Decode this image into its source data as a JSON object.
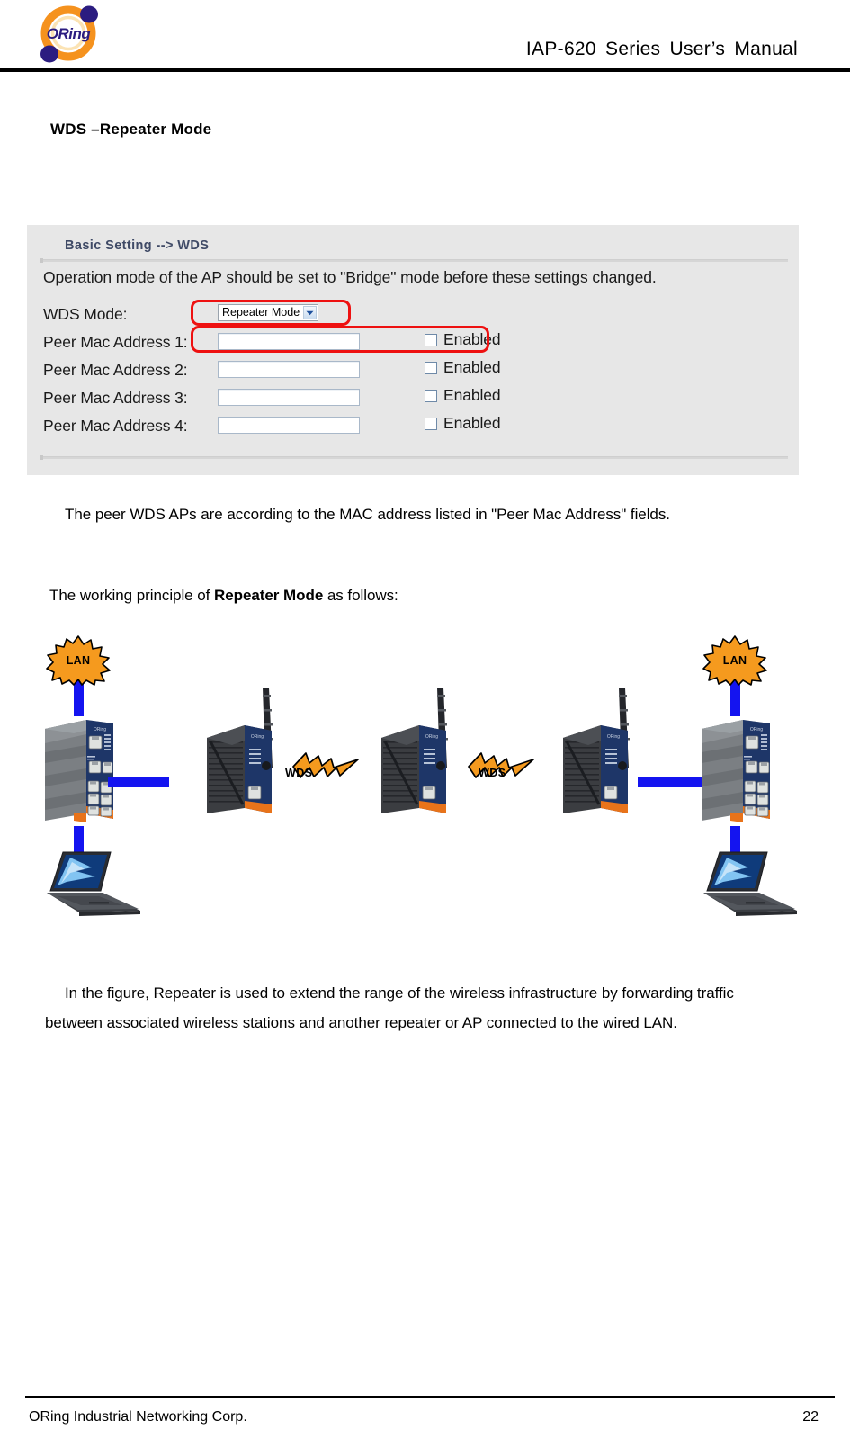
{
  "header": {
    "title": "IAP-620  Series  User’s  Manual",
    "logo_text": "ORing"
  },
  "section": {
    "heading": "WDS –Repeater Mode"
  },
  "panel": {
    "title": "Basic Setting --> WDS",
    "note": "Operation mode of the AP should be set to \"Bridge\" mode before these settings changed.",
    "rows": [
      {
        "label": "WDS Mode:",
        "type": "select",
        "value": "Repeater Mode",
        "checkbox_label": null,
        "checked": false,
        "highlighted": true
      },
      {
        "label": "Peer Mac Address 1:",
        "type": "text",
        "value": "",
        "checkbox_label": "Enabled",
        "checked": false,
        "highlighted": true
      },
      {
        "label": "Peer Mac Address 2:",
        "type": "text",
        "value": "",
        "checkbox_label": "Enabled",
        "checked": false,
        "highlighted": false
      },
      {
        "label": "Peer Mac Address 3:",
        "type": "text",
        "value": "",
        "checkbox_label": "Enabled",
        "checked": false,
        "highlighted": false
      },
      {
        "label": "Peer Mac Address 4:",
        "type": "text",
        "value": "",
        "checkbox_label": "Enabled",
        "checked": false,
        "highlighted": false
      }
    ]
  },
  "body": {
    "paragraph_1": "The peer WDS APs are according to the MAC address listed in \"Peer Mac Address\" fields.",
    "paragraph_2_prefix": "The working principle of ",
    "paragraph_2_bold": "Repeater Mode",
    "paragraph_2_suffix": " as follows:",
    "paragraph_3": "In the figure, Repeater is used to extend the range of the wireless infrastructure by forwarding traffic between associated wireless stations and another repeater or AP connected to the wired LAN."
  },
  "diagram": {
    "lan_burst_left": "LAN",
    "lan_burst_right": "LAN",
    "wds_label_1": "WDS",
    "wds_label_2": "WDS",
    "colors": {
      "burst_fill": "#F59A1E",
      "bolt_fill": "#F59A1E",
      "wire": "#1414F0",
      "device_body": "#1e3668",
      "device_case": "#6e7377",
      "device_accent": "#e8731a"
    }
  },
  "footer": {
    "company": "ORing Industrial Networking Corp.",
    "page_number": "22"
  }
}
